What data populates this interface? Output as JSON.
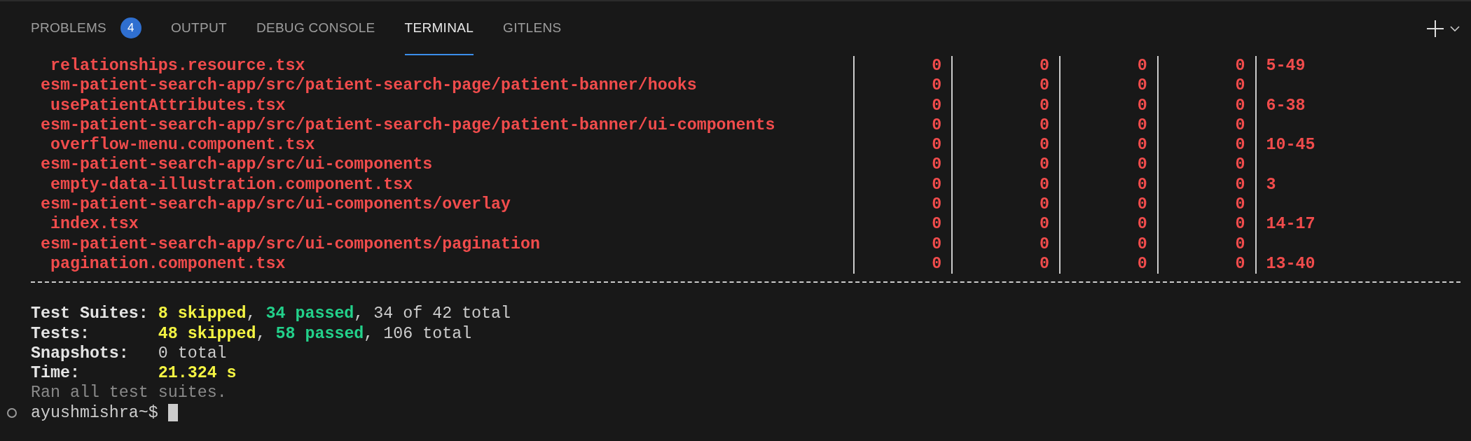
{
  "tabs": [
    {
      "label": "PROBLEMS",
      "selected": false,
      "badge": "4"
    },
    {
      "label": "OUTPUT",
      "selected": false
    },
    {
      "label": "DEBUG CONSOLE",
      "selected": false
    },
    {
      "label": "TERMINAL",
      "selected": true
    },
    {
      "label": "GITLENS",
      "selected": false
    }
  ],
  "coverage_rows": [
    {
      "kind": "file",
      "name": "relationships.resource.tsx",
      "values": [
        "0",
        "0",
        "0",
        "0"
      ],
      "uncovered": "5-49"
    },
    {
      "kind": "folder",
      "name": "esm-patient-search-app/src/patient-search-page/patient-banner/hooks",
      "values": [
        "0",
        "0",
        "0",
        "0"
      ]
    },
    {
      "kind": "file",
      "name": "usePatientAttributes.tsx",
      "values": [
        "0",
        "0",
        "0",
        "0"
      ],
      "uncovered": "6-38"
    },
    {
      "kind": "folder",
      "name": "esm-patient-search-app/src/patient-search-page/patient-banner/ui-components",
      "values": [
        "0",
        "0",
        "0",
        "0"
      ]
    },
    {
      "kind": "file",
      "name": "overflow-menu.component.tsx",
      "values": [
        "0",
        "0",
        "0",
        "0"
      ],
      "uncovered": "10-45"
    },
    {
      "kind": "folder",
      "name": "esm-patient-search-app/src/ui-components",
      "values": [
        "0",
        "0",
        "0",
        "0"
      ]
    },
    {
      "kind": "file",
      "name": "empty-data-illustration.component.tsx",
      "values": [
        "0",
        "0",
        "0",
        "0"
      ],
      "uncovered": "3"
    },
    {
      "kind": "folder",
      "name": "esm-patient-search-app/src/ui-components/overlay",
      "values": [
        "0",
        "0",
        "0",
        "0"
      ]
    },
    {
      "kind": "file",
      "name": "index.tsx",
      "values": [
        "0",
        "0",
        "0",
        "0"
      ],
      "uncovered": "14-17"
    },
    {
      "kind": "folder",
      "name": "esm-patient-search-app/src/ui-components/pagination",
      "values": [
        "0",
        "0",
        "0",
        "0"
      ]
    },
    {
      "kind": "file",
      "name": "pagination.component.tsx",
      "values": [
        "0",
        "0",
        "0",
        "0"
      ],
      "uncovered": "13-40"
    }
  ],
  "summary": [
    {
      "label": "Test Suites:",
      "parts": [
        {
          "kind": "skipped",
          "text": "8 skipped"
        },
        {
          "kind": "plain",
          "text": ", "
        },
        {
          "kind": "passed",
          "text": "34 passed"
        },
        {
          "kind": "plain",
          "text": ", 34 of 42 total"
        }
      ]
    },
    {
      "label": "Tests:",
      "parts": [
        {
          "kind": "skipped",
          "text": "48 skipped"
        },
        {
          "kind": "plain",
          "text": ", "
        },
        {
          "kind": "passed",
          "text": "58 passed"
        },
        {
          "kind": "plain",
          "text": ", 106 total"
        }
      ]
    },
    {
      "label": "Snapshots:",
      "parts": [
        {
          "kind": "plain",
          "text": "0 total"
        }
      ]
    },
    {
      "label": "Time:",
      "parts": [
        {
          "kind": "skipped",
          "text": "21.324 s"
        }
      ]
    }
  ],
  "status_line": "Ran all test suites.",
  "prompt": "ayushmishra~$"
}
